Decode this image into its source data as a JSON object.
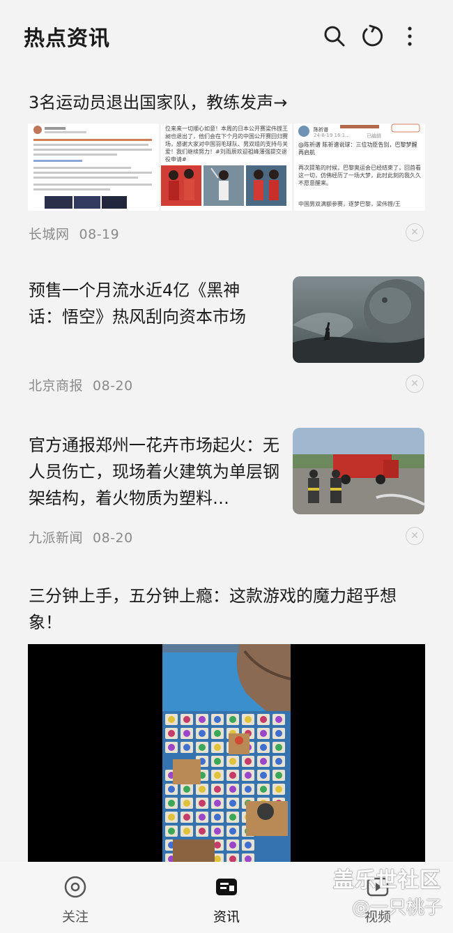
{
  "header": {
    "title": "热点资讯"
  },
  "articles": [
    {
      "title": "3名运动员退出国家队，教练发声→",
      "source": "长城网",
      "date": "08-19"
    },
    {
      "title": "预售一个月流水近4亿《黑神话：悟空》热风刮向资本市场",
      "source": "北京商报",
      "date": "08-20"
    },
    {
      "title": "官方通报郑州一花卉市场起火：无人员伤亡，现场着火建筑为单层钢架结构，着火物质为塑料…",
      "source": "九派新闻",
      "date": "08-20"
    },
    {
      "title": "三分钟上手，五分钟上瘾：这款游戏的魔力超乎想象！"
    }
  ],
  "thumb2": {
    "text": "位来来一切顺心如意！本周的日本公开赛梁伟铿王昶也退出了，他们会在下个月的中国公开赛回归赛场，感谢大家对中国羽毛球队、男双组的支持与关爱！我们继续努力！#刘雨辰欢迎祖峰薄强提交退役申请#"
  },
  "thumb3": {
    "user": "陈祈谱",
    "date": "24-8-19 16:1...",
    "status": "已编辑",
    "quote": "@陈祈谱 陈祈谱说球：三位功臣告别，巴黎梦醒再启航",
    "body": "再次提笔的时候，巴黎奥运会已经结束了，回首看这一切，仿佛经历了一场大梦，此时此刻的我久久不愿意醒来。",
    "footer": "中国男双满额参赛，逐梦巴黎，梁伟铿/王"
  },
  "nav": {
    "items": [
      {
        "label": "关注",
        "icon": "target-icon"
      },
      {
        "label": "资讯",
        "icon": "news-icon"
      },
      {
        "label": "视频",
        "icon": "play-icon"
      }
    ]
  },
  "watermark": {
    "line1": "盖乐世社区",
    "line2": "@一只桃子"
  }
}
